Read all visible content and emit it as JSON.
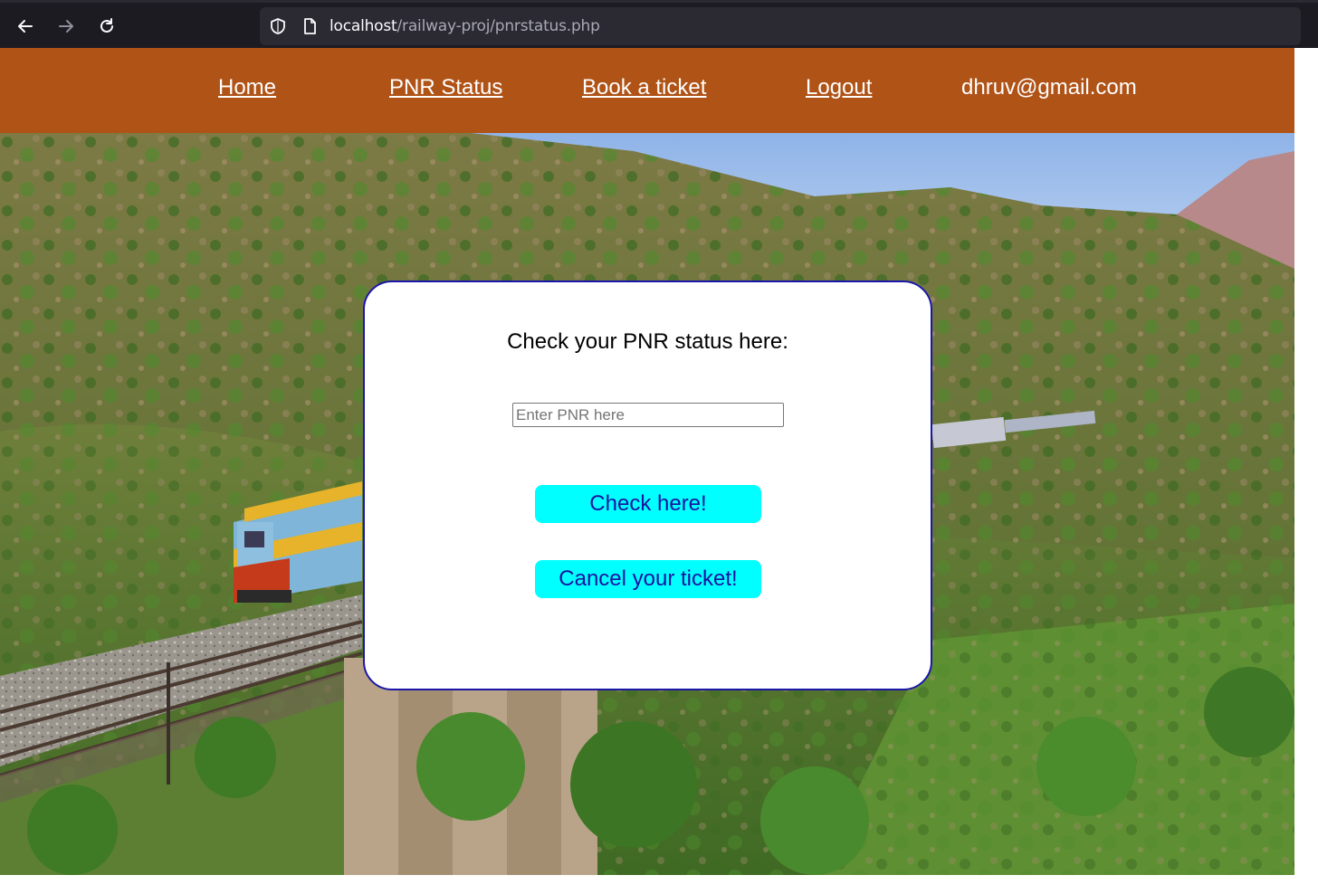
{
  "browser": {
    "url_host": "localhost",
    "url_path": "/railway-proj/pnrstatus.php",
    "icons": [
      "back-arrow-icon",
      "forward-arrow-icon",
      "reload-icon",
      "shield-icon",
      "page-icon"
    ]
  },
  "header": {
    "background": "#b05317",
    "nav": {
      "home": "Home",
      "pnr_status": "PNR Status",
      "book_ticket": "Book a ticket",
      "logout": "Logout"
    },
    "user_email": "dhruv@gmail.com"
  },
  "card": {
    "title": "Check your PNR status here:",
    "input_placeholder": "Enter PNR here",
    "input_value": "",
    "check_button": "Check here!",
    "cancel_button": "Cancel your ticket!",
    "border_color": "#1a17a8",
    "button_color": "#00ffff"
  }
}
